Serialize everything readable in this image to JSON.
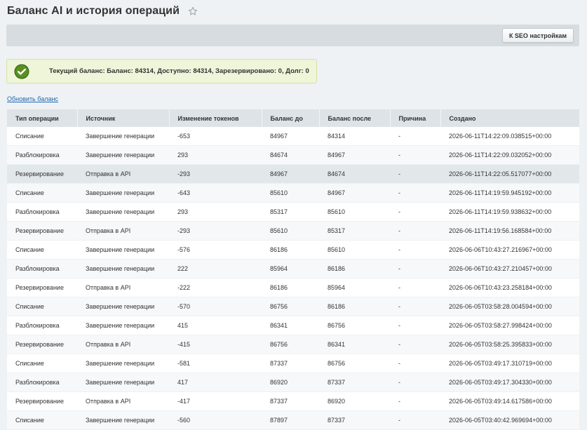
{
  "page": {
    "title": "Баланс AI и история операций",
    "seo_button": "К SEO настройкам",
    "notice": "Текущий баланс: Баланс: 84314, Доступно: 84314, Зарезервировано: 0, Долг: 0",
    "refresh_link": "Обновить баланс",
    "selected_row_index": 2,
    "colors": {
      "accent": "#2067b0",
      "success": "#5b8f22",
      "notice_bg": "#eef5d9"
    }
  },
  "table": {
    "headers": [
      "Тип операции",
      "Источник",
      "Изменение токенов",
      "Баланс до",
      "Баланс после",
      "Причина",
      "Создано"
    ],
    "rows": [
      [
        "Списание",
        "Завершение генерации",
        "-653",
        "84967",
        "84314",
        "-",
        "2026-06-11T14:22:09.038515+00:00"
      ],
      [
        "Разблокировка",
        "Завершение генерации",
        "293",
        "84674",
        "84967",
        "-",
        "2026-06-11T14:22:09.032052+00:00"
      ],
      [
        "Резервирование",
        "Отправка в API",
        "-293",
        "84967",
        "84674",
        "-",
        "2026-06-11T14:22:05.517077+00:00"
      ],
      [
        "Списание",
        "Завершение генерации",
        "-643",
        "85610",
        "84967",
        "-",
        "2026-06-11T14:19:59.945192+00:00"
      ],
      [
        "Разблокировка",
        "Завершение генерации",
        "293",
        "85317",
        "85610",
        "-",
        "2026-06-11T14:19:59.938632+00:00"
      ],
      [
        "Резервирование",
        "Отправка в API",
        "-293",
        "85610",
        "85317",
        "-",
        "2026-06-11T14:19:56.168584+00:00"
      ],
      [
        "Списание",
        "Завершение генерации",
        "-576",
        "86186",
        "85610",
        "-",
        "2026-06-06T10:43:27.216967+00:00"
      ],
      [
        "Разблокировка",
        "Завершение генерации",
        "222",
        "85964",
        "86186",
        "-",
        "2026-06-06T10:43:27.210457+00:00"
      ],
      [
        "Резервирование",
        "Отправка в API",
        "-222",
        "86186",
        "85964",
        "-",
        "2026-06-06T10:43:23.258184+00:00"
      ],
      [
        "Списание",
        "Завершение генерации",
        "-570",
        "86756",
        "86186",
        "-",
        "2026-06-05T03:58:28.004594+00:00"
      ],
      [
        "Разблокировка",
        "Завершение генерации",
        "415",
        "86341",
        "86756",
        "-",
        "2026-06-05T03:58:27.998424+00:00"
      ],
      [
        "Резервирование",
        "Отправка в API",
        "-415",
        "86756",
        "86341",
        "-",
        "2026-06-05T03:58:25.395833+00:00"
      ],
      [
        "Списание",
        "Завершение генерации",
        "-581",
        "87337",
        "86756",
        "-",
        "2026-06-05T03:49:17.310719+00:00"
      ],
      [
        "Разблокировка",
        "Завершение генерации",
        "417",
        "86920",
        "87337",
        "-",
        "2026-06-05T03:49:17.304330+00:00"
      ],
      [
        "Резервирование",
        "Отправка в API",
        "-417",
        "87337",
        "86920",
        "-",
        "2026-06-05T03:49:14.617586+00:00"
      ],
      [
        "Списание",
        "Завершение генерации",
        "-560",
        "87897",
        "87337",
        "-",
        "2026-06-05T03:40:42.969694+00:00"
      ]
    ]
  }
}
